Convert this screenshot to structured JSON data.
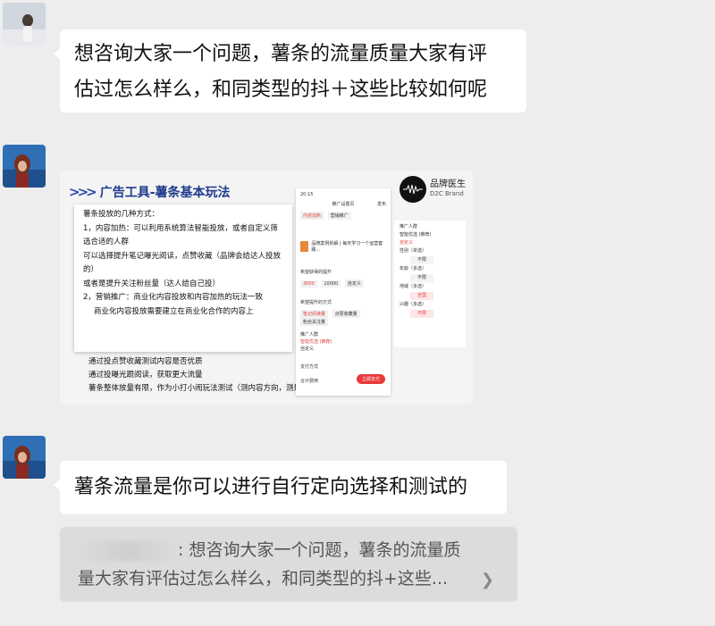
{
  "messages": {
    "msg1": {
      "line1": "想咨询大家一个问题，薯条的流量质量大家有评",
      "line2": "估过怎么样么，和同类型的抖＋这些比较如何呢"
    },
    "image": {
      "title": "广告工具-薯条基本玩法",
      "logo_line1": "品牌医生",
      "logo_line2": "D2C Brand",
      "card_lines": [
        "薯条投放的几种方式：",
        "1，内容加热：可以利用系统算法智能投放，或者自定义筛",
        "选合适的人群",
        "可以选择提升笔记曝光阅读，点赞收藏（品牌会给达人投放",
        "的）",
        "或者是提升关注粉丝量（达人给自己投）",
        "2，营销推广：商业化内容投放和内容加热的玩法一致",
        "商业化内容投放需要建立在商业化合作的内容上"
      ],
      "notes": [
        "通过投点赞收藏测试内容是否优质",
        "通过投曝光跟阅读，获取更大流量",
        "薯条整体放量有限，作为小打小闹玩法测试（测内容方向，测是否限流）"
      ],
      "phone": {
        "time": "20:15",
        "header": "推广设置页",
        "header_right": "发布",
        "tab1": "内容加热",
        "tab2": "营销推广",
        "note_title": "品牌案例拆解 | 每天学习一个运营套路...",
        "section1": "希望获得的提升",
        "opt1": "3000",
        "opt2": "10000",
        "opt3": "自定义",
        "section2": "希望提升的方式",
        "tag1": "笔记阅读量",
        "tag2": "点赞收藏量",
        "tag3": "粉丝关注量",
        "section3": "推广人群",
        "radio1": "智能优选 (推荐)",
        "radio2": "自定义",
        "pay_label": "支付方式",
        "total_label": "合计费用",
        "pay_button": "立即支付"
      },
      "panel": {
        "title": "推广人群",
        "radio1": "智能优选 (推荐)",
        "radio2": "自定义",
        "gender": "性别（单选）",
        "gender_val": "不限",
        "age": "年龄（多选）",
        "age_val": "不限",
        "region": "地域（多选）",
        "region_val": "全国",
        "interest": "兴趣（多选）",
        "interest_val": "不限"
      }
    },
    "msg3": {
      "text": "薯条流量是你可以进行自行定向选择和测试的"
    },
    "quote": {
      "line1": ": 想咨询大家一个问题，薯条的流量质",
      "line2": "量大家有评估过怎么样么，和同类型的抖+这些..."
    }
  }
}
